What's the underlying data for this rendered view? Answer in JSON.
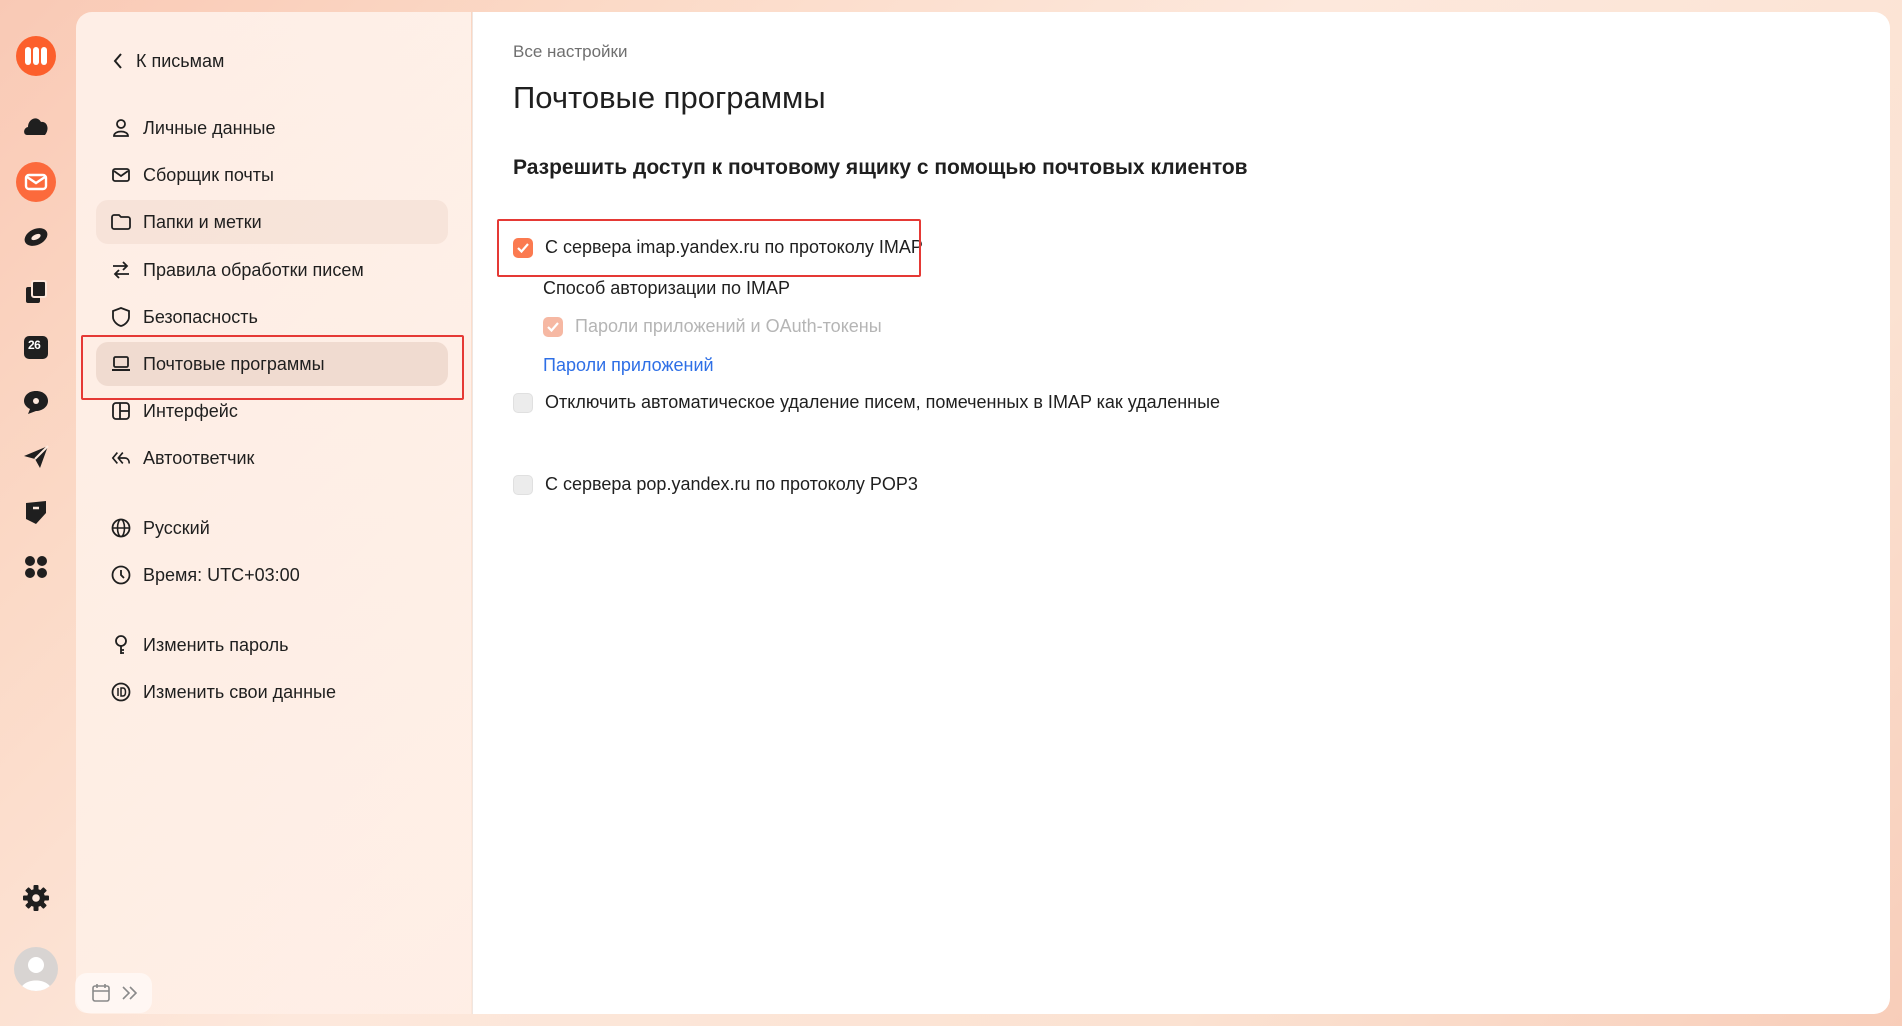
{
  "rail": {
    "calendar_badge": "26",
    "icons": [
      "logo-icon",
      "cloud-icon",
      "mail-icon",
      "messenger-icon",
      "documents-icon",
      "calendar-icon",
      "chat-icon",
      "telemost-icon",
      "notes-icon",
      "apps-icon"
    ]
  },
  "nav": {
    "back_label": "К письмам",
    "items": [
      {
        "label": "Личные данные",
        "icon": "user-icon"
      },
      {
        "label": "Сборщик почты",
        "icon": "mail-collector-icon"
      },
      {
        "label": "Папки и метки",
        "icon": "folder-icon"
      },
      {
        "label": "Правила обработки писем",
        "icon": "rules-icon"
      },
      {
        "label": "Безопасность",
        "icon": "shield-icon"
      },
      {
        "label": "Почтовые программы",
        "icon": "laptop-icon"
      },
      {
        "label": "Интерфейс",
        "icon": "layout-icon"
      },
      {
        "label": "Автоответчик",
        "icon": "reply-all-icon"
      }
    ],
    "language_label": "Русский",
    "time_label": "Время: UTC+03:00",
    "change_password_label": "Изменить пароль",
    "change_data_label": "Изменить свои данные"
  },
  "main": {
    "breadcrumb": "Все настройки",
    "title": "Почтовые программы",
    "section_title": "Разрешить доступ к почтовому ящику с помощью почтовых клиентов",
    "imap_label": "С сервера imap.yandex.ru по протоколу IMAP",
    "imap_checked": true,
    "imap_auth_label": "Способ авторизации по IMAP",
    "app_passwords_oauth_label": "Пароли приложений и OAuth-токены",
    "app_passwords_link": "Пароли приложений",
    "disable_auto_delete_label": "Отключить автоматическое удаление писем, помеченных в IMAP как удаленные",
    "disable_auto_delete_checked": false,
    "pop3_label": "С сервера pop.yandex.ru по протоколу POP3",
    "pop3_checked": false
  },
  "colors": {
    "accent": "#fb7a50",
    "link": "#2e6fe6",
    "highlight": "#e53935"
  }
}
